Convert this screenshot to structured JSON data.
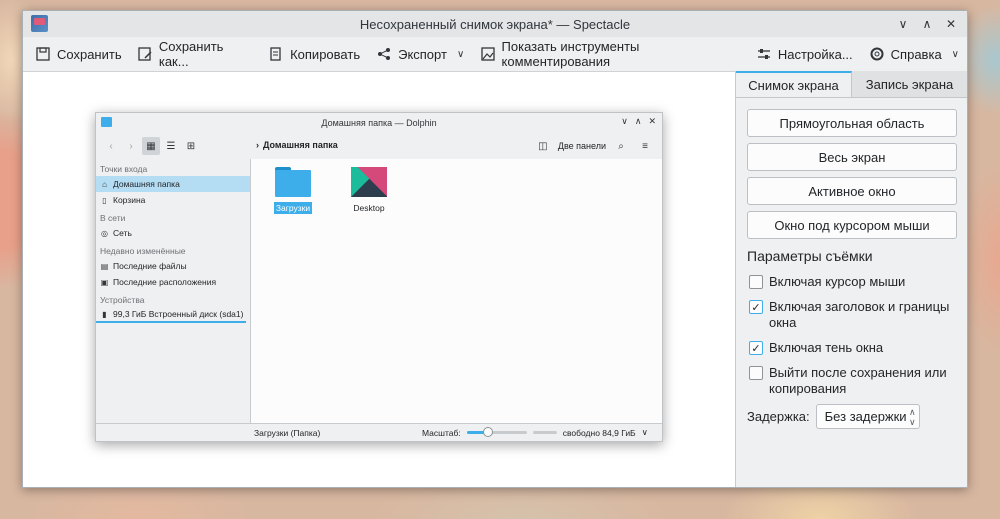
{
  "window": {
    "title": "Несохраненный снимок экрана* — Spectacle"
  },
  "toolbar": {
    "save": "Сохранить",
    "save_as": "Сохранить как...",
    "copy": "Копировать",
    "export": "Экспорт",
    "annotate": "Показать инструменты комментирования",
    "configure": "Настройка...",
    "help": "Справка"
  },
  "tabs": {
    "screenshot": "Снимок экрана",
    "recording": "Запись экрана"
  },
  "capture": {
    "rect": "Прямоугольная область",
    "fullscreen": "Весь экран",
    "active": "Активное окно",
    "under_cursor": "Окно под курсором мыши"
  },
  "options": {
    "title": "Параметры съёмки",
    "items": [
      {
        "label": "Включая курсор мыши",
        "checked": false
      },
      {
        "label": "Включая заголовок и границы окна",
        "checked": true
      },
      {
        "label": "Включая тень окна",
        "checked": true
      },
      {
        "label": "Выйти после сохранения или копирования",
        "checked": false
      }
    ],
    "delay_label": "Задержка:",
    "delay_value": "Без задержки"
  },
  "dolphin": {
    "title": "Домашняя папка — Dolphin",
    "breadcrumb": "Домашняя папка",
    "split": "Две панели",
    "places": {
      "entry_points": "Точки входа",
      "home": "Домашняя папка",
      "trash": "Корзина",
      "network_head": "В сети",
      "network": "Сеть",
      "recent_head": "Недавно изменённые",
      "recent_files": "Последние файлы",
      "recent_locations": "Последние расположения",
      "devices_head": "Устройства",
      "disk": "99,3 ГиБ Встроенный диск (sda1)"
    },
    "files": [
      {
        "name": "Загрузки",
        "type": "folder",
        "selected": true
      },
      {
        "name": "Desktop",
        "type": "desktop",
        "selected": false
      }
    ],
    "status": {
      "selection": "Загрузки (Папка)",
      "zoom_label": "Масштаб:",
      "free": "свободно 84,9 ГиБ",
      "zoom_fraction": 0.35
    }
  },
  "colors": {
    "accent": "#3daee9",
    "window_bg": "#eff0f1"
  }
}
